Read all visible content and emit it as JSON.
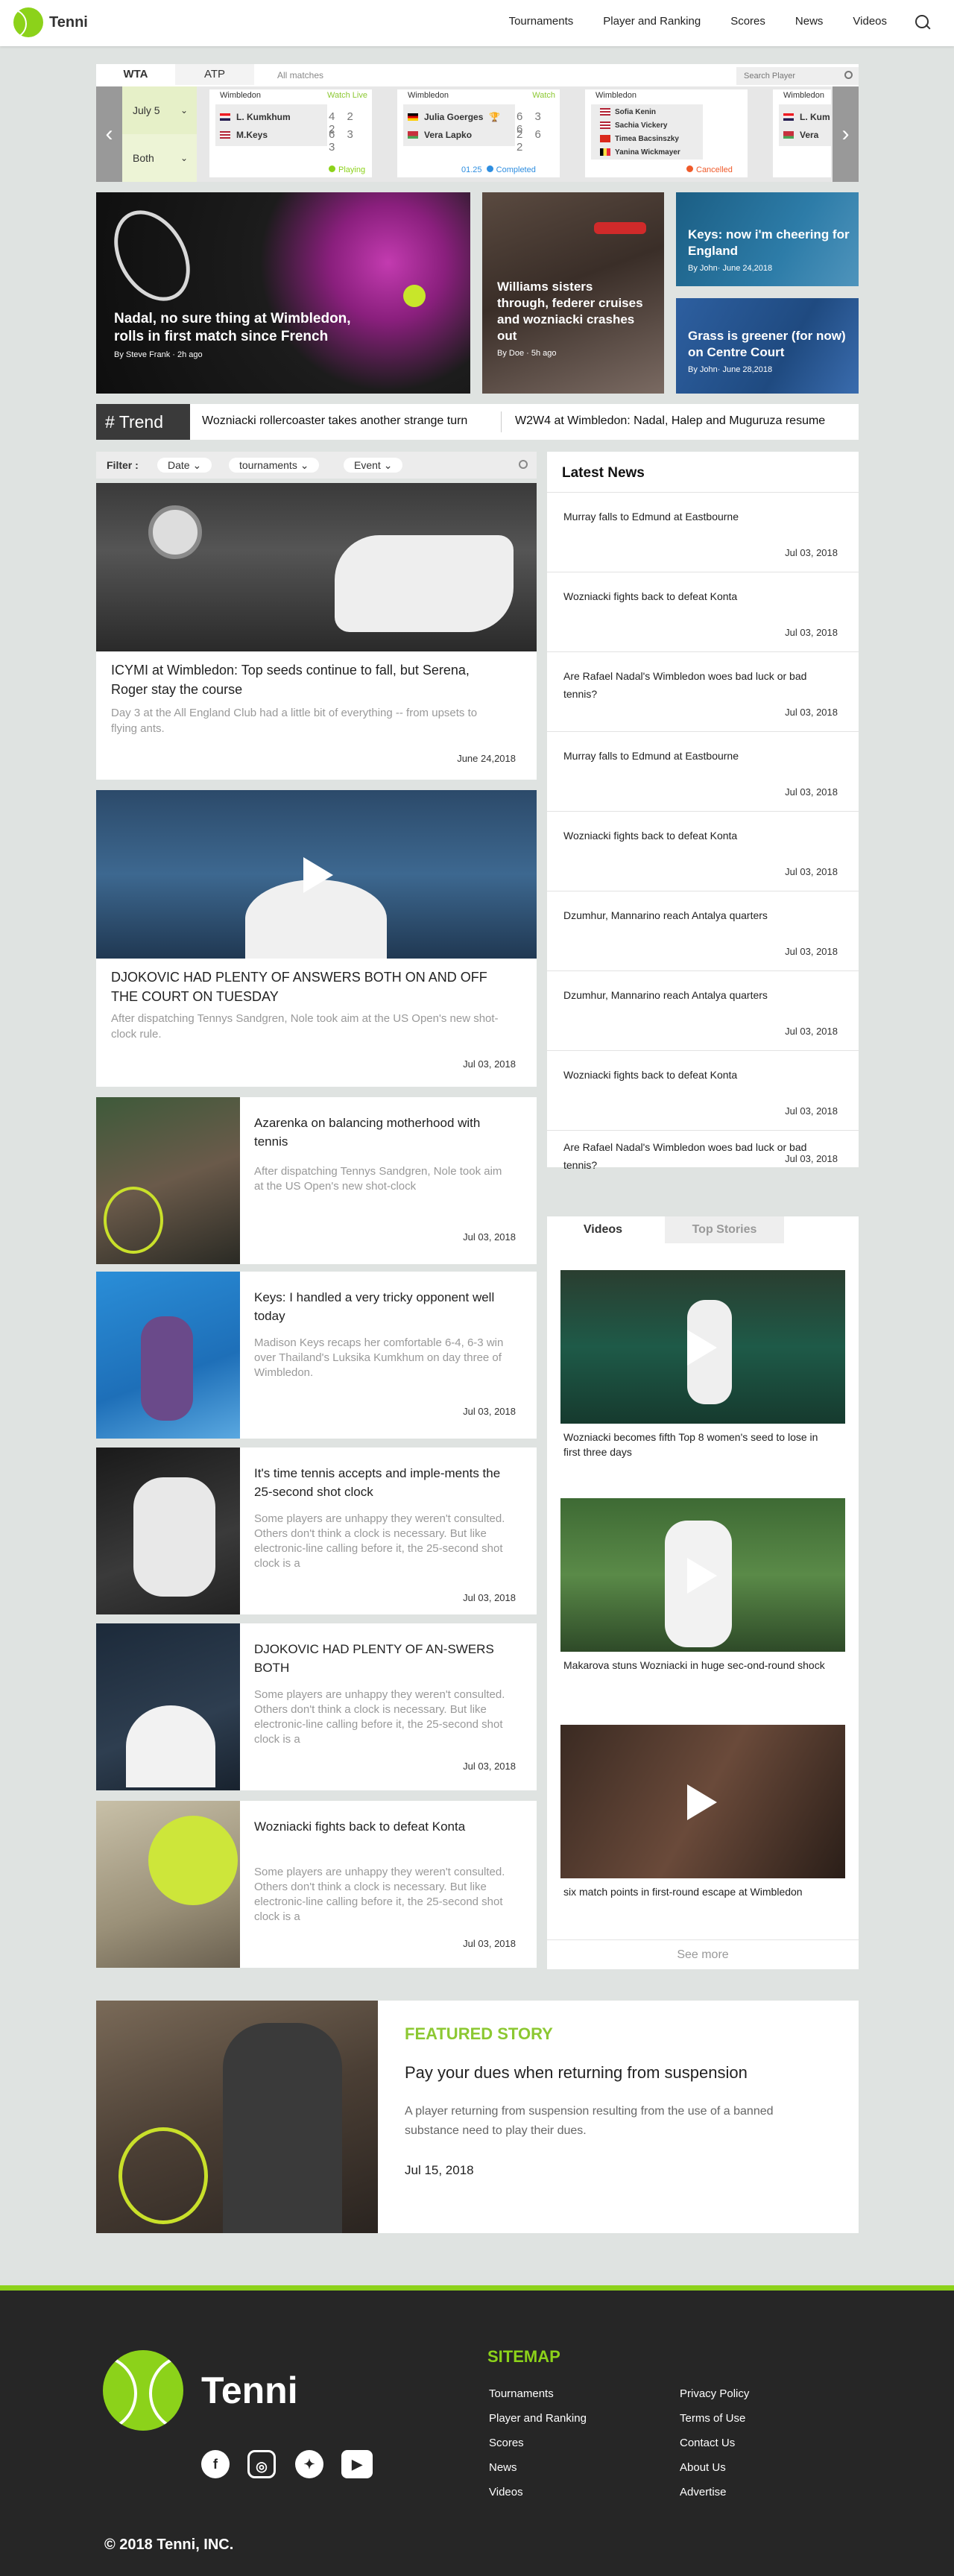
{
  "brand": {
    "name": "Tenni"
  },
  "nav": [
    "Tournaments",
    "Player and Ranking",
    "Scores",
    "News",
    "Videos"
  ],
  "matches": {
    "tabs": [
      "WTA",
      "ATP"
    ],
    "all": "All matches",
    "search_placeholder": "Search Player",
    "date": "July 5",
    "filter": "Both",
    "cards": [
      {
        "tournament": "Wimbledon",
        "watch": "Watch Live",
        "p1": "L. Kumkhum",
        "p2": "M.Keys",
        "s1": "4 2 2",
        "s2": "6 3 3",
        "status": "Playing",
        "status_color": "#8cd21a",
        "time": ""
      },
      {
        "tournament": "Wimbledon",
        "watch": "Watch",
        "p1": "Julia Goerges",
        "p2": "Vera Lapko",
        "s1": "6 3 6",
        "s2": "2 6 2",
        "status": "Completed",
        "status_color": "#2e8ee0",
        "time": "01.25"
      },
      {
        "tournament": "Wimbledon",
        "watch": "",
        "players": [
          "Sofia Kenin",
          "Sachia Vickery",
          "Timea Bacsinszky",
          "Yanina Wickmayer"
        ],
        "status": "Cancelled",
        "status_color": "#ef5a2a"
      },
      {
        "tournament": "Wimbledon",
        "watch": "",
        "p1": "L. Kum",
        "p2": "Vera",
        "status": ""
      }
    ]
  },
  "heroes": [
    {
      "title": "Nadal, no sure thing at Wimbledon, rolls in first match since French",
      "meta": "By Steve Frank · 2h ago"
    },
    {
      "title": "Williams sisters through, federer cruises and wozniacki crashes out",
      "meta": "By Doe · 5h ago"
    },
    {
      "title": "Keys: now i'm cheering for England",
      "meta": "By John· June 24,2018"
    },
    {
      "title": "Grass is greener (for now) on Centre Court",
      "meta": "By John· June 28,2018"
    }
  ],
  "trend": {
    "label": "# Trend",
    "items": [
      "Wozniacki rollercoaster takes another strange turn",
      "W2W4 at Wimbledon: Nadal, Halep and Muguruza resume"
    ]
  },
  "filter": {
    "label": "Filter :",
    "chips": [
      "Date",
      "tournaments",
      "Event"
    ]
  },
  "articles": [
    {
      "title": "ICYMI at Wimbledon: Top seeds continue to fall, but Serena, Roger stay the course",
      "desc": "Day 3 at the All England Club had a little bit of everything -- from upsets to flying ants.",
      "date": "June 24,2018"
    },
    {
      "title": "DJOKOVIC HAD PLENTY OF ANSWERS BOTH ON AND OFF THE COURT ON TUESDAY",
      "desc": "After dispatching Tennys Sandgren, Nole took aim at the US Open's new shot-clock rule.",
      "date": "Jul 03, 2018"
    },
    {
      "title": "Azarenka on balancing motherhood with tennis",
      "desc": "After dispatching Tennys Sandgren, Nole took aim at the US Open's new shot-clock",
      "date": "Jul 03, 2018"
    },
    {
      "title": "Keys: I handled a very tricky opponent well today",
      "desc": "Madison Keys recaps her comfortable 6-4, 6-3 win over Thailand's Luksika Kumkhum on day three of Wimbledon.",
      "date": "Jul 03, 2018"
    },
    {
      "title": "It's time tennis accepts and imple-ments the 25-second shot clock",
      "desc": "Some players are unhappy they weren't consulted. Others don't think a clock is necessary. But like electronic-line calling before it, the 25-second shot clock is a",
      "date": "Jul 03, 2018"
    },
    {
      "title": "DJOKOVIC HAD PLENTY OF AN-SWERS BOTH",
      "desc": "Some players are unhappy they weren't consulted. Others don't think a clock is necessary. But like electronic-line calling before it, the 25-second shot clock is a",
      "date": "Jul 03, 2018"
    },
    {
      "title": "Wozniacki fights back to defeat Konta",
      "desc": "Some players are unhappy they weren't consulted. Others don't think a clock is necessary. But like electronic-line calling before it, the 25-second shot clock is a",
      "date": "Jul 03, 2018"
    }
  ],
  "latest": {
    "title": "Latest News",
    "items": [
      {
        "t": "Murray falls to Edmund at Eastbourne",
        "d": "Jul 03, 2018"
      },
      {
        "t": "Wozniacki fights back to defeat Konta",
        "d": "Jul 03, 2018"
      },
      {
        "t": "Are Rafael Nadal's Wimbledon woes bad luck or bad tennis?",
        "d": "Jul 03, 2018"
      },
      {
        "t": "Murray falls to Edmund at Eastbourne",
        "d": "Jul 03, 2018"
      },
      {
        "t": "Wozniacki fights back to defeat Konta",
        "d": "Jul 03, 2018"
      },
      {
        "t": "Dzumhur, Mannarino reach Antalya quarters",
        "d": "Jul 03, 2018"
      },
      {
        "t": "Dzumhur, Mannarino reach Antalya quarters",
        "d": "Jul 03, 2018"
      },
      {
        "t": "Wozniacki fights back to defeat Konta",
        "d": "Jul 03, 2018"
      },
      {
        "t": "Are Rafael Nadal's Wimbledon woes bad luck or bad tennis?",
        "d": "Jul 03, 2018"
      }
    ]
  },
  "videos": {
    "tabs": [
      "Videos",
      "Top Stories"
    ],
    "items": [
      "Wozniacki becomes fifth Top 8 women's seed to lose in first three days",
      "Makarova stuns Wozniacki in huge sec-ond-round shock",
      "six match points in first-round escape at Wimbledon"
    ],
    "more": "See more"
  },
  "featured": {
    "kicker": "FEATURED STORY",
    "title": "Pay your dues when returning from suspension",
    "desc": "A player returning from suspension resulting from the use of a banned substance need to play their dues.",
    "date": "Jul 15, 2018"
  },
  "footer": {
    "sitemap": "SITEMAP",
    "col1": [
      "Tournaments",
      "Player and Ranking",
      "Scores",
      "News",
      "Videos"
    ],
    "col2": [
      "Privacy Policy",
      "Terms of Use",
      "Contact Us",
      "About Us",
      "Advertise"
    ],
    "copyright": "© 2018 Tenni, INC.",
    "social": [
      "facebook-icon",
      "instagram-icon",
      "twitter-icon",
      "youtube-icon"
    ]
  },
  "colors": {
    "accent": "#8cd21a"
  }
}
